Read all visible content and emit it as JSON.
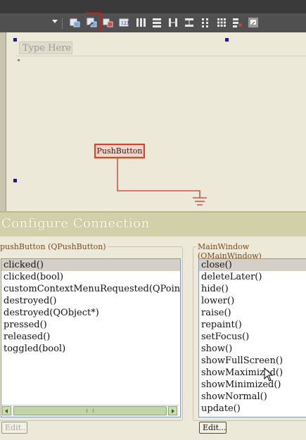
{
  "toolbar": {
    "buttons": [
      {
        "name": "edit-widgets-icon"
      },
      {
        "name": "edit-signals-slots-icon"
      },
      {
        "name": "edit-buddies-icon"
      },
      {
        "name": "edit-tab-order-icon"
      },
      {
        "name": "layout-horizontal-icon"
      },
      {
        "name": "layout-vertical-icon"
      },
      {
        "name": "layout-horizontal-splitter-icon"
      },
      {
        "name": "layout-vertical-splitter-icon"
      },
      {
        "name": "layout-form-icon"
      },
      {
        "name": "layout-grid-icon"
      },
      {
        "name": "break-layout-icon"
      },
      {
        "name": "adjust-size-icon"
      }
    ],
    "highlight_color": "#d02020"
  },
  "form": {
    "menu_placeholder": "Type Here",
    "push_button_label": "PushButton",
    "connection_color": "#c0392b"
  },
  "dialog": {
    "title": "Configure Connection",
    "sender": {
      "group_title": "pushButton (QPushButton)",
      "signals": [
        "clicked()",
        "clicked(bool)",
        "customContextMenuRequested(QPoint)",
        "destroyed()",
        "destroyed(QObject*)",
        "pressed()",
        "released()",
        "toggled(bool)"
      ],
      "selected_index": 0,
      "edit_label": "Edit..."
    },
    "receiver": {
      "group_title": "MainWindow (QMainWindow)",
      "slots": [
        "close()",
        "deleteLater()",
        "hide()",
        "lower()",
        "raise()",
        "repaint()",
        "setFocus()",
        "show()",
        "showFullScreen()",
        "showMaximized()",
        "showMinimized()",
        "showNormal()",
        "update()"
      ],
      "selected_index": 0,
      "edit_label": "Edit..."
    }
  }
}
